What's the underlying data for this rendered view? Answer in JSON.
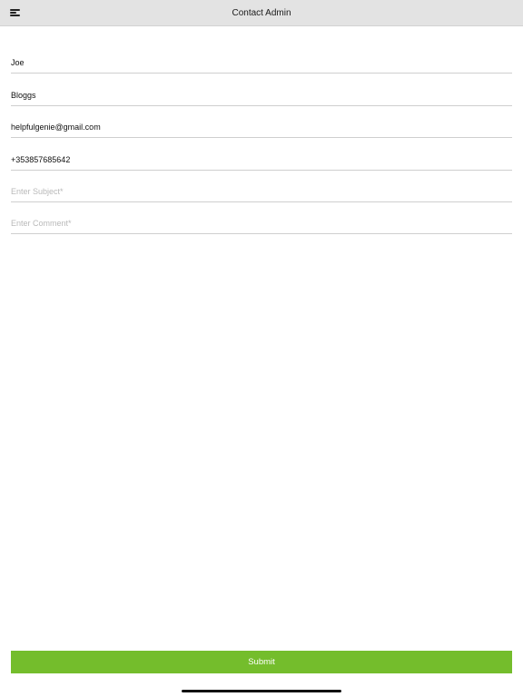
{
  "navbar": {
    "title": "Contact Admin",
    "menu_icon": "hamburger-menu-icon"
  },
  "form": {
    "first_name": {
      "value": "Joe",
      "placeholder": ""
    },
    "last_name": {
      "value": "Bloggs",
      "placeholder": ""
    },
    "email": {
      "value": "helpfulgenie@gmail.com",
      "placeholder": ""
    },
    "phone": {
      "value": "+353857685642",
      "placeholder": ""
    },
    "subject": {
      "value": "",
      "placeholder": "Enter Subject*"
    },
    "comment": {
      "value": "",
      "placeholder": "Enter Comment*"
    }
  },
  "submit": {
    "label": "Submit"
  },
  "colors": {
    "navbar_bg": "#e3e3e3",
    "accent": "#74bd2c",
    "divider": "#cfcfcf",
    "placeholder": "#b9b9b9"
  }
}
